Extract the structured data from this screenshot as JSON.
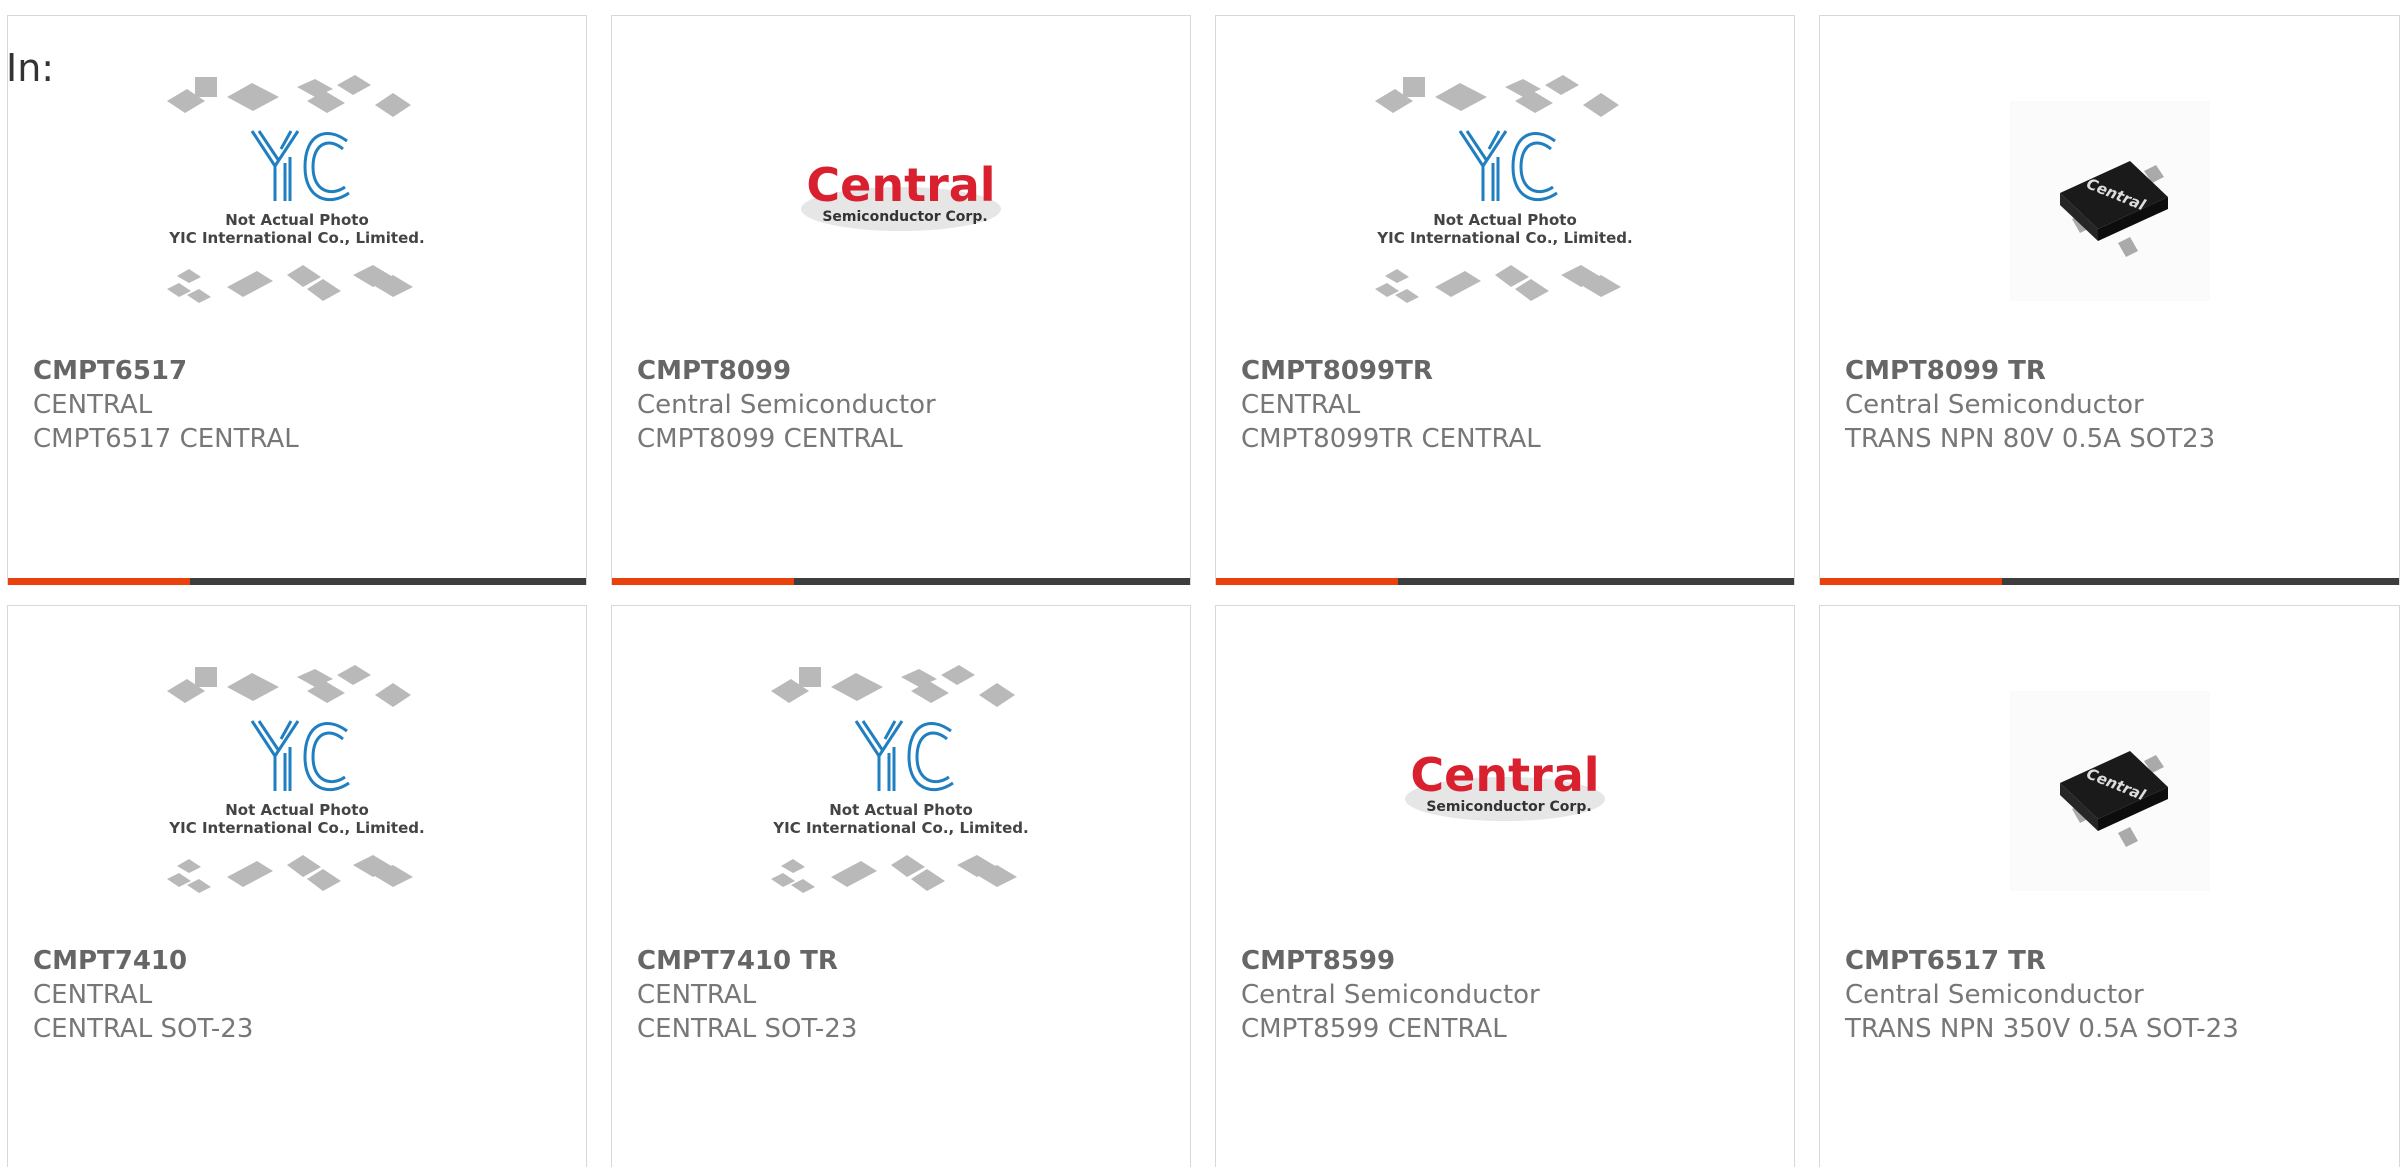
{
  "header": {
    "in_label": "In:"
  },
  "colors": {
    "accent": "#e8410c",
    "bar": "#3d3d3d",
    "yic_blue": "#1f7fc0",
    "central_red": "#d8202e"
  },
  "products": [
    {
      "part": "CMPT6517",
      "manufacturer": "CENTRAL",
      "description": "CMPT6517 CENTRAL",
      "image": "yic-placeholder",
      "image_caption_1": "Not Actual Photo",
      "image_caption_2": "YIC International Co., Limited."
    },
    {
      "part": "CMPT8099",
      "manufacturer": "Central Semiconductor",
      "description": "CMPT8099 CENTRAL",
      "image": "central-logo",
      "logo_main": "Central",
      "logo_sub": "Semiconductor Corp."
    },
    {
      "part": "CMPT8099TR",
      "manufacturer": "CENTRAL",
      "description": "CMPT8099TR CENTRAL",
      "image": "yic-placeholder",
      "image_caption_1": "Not Actual Photo",
      "image_caption_2": "YIC International Co., Limited."
    },
    {
      "part": "CMPT8099 TR",
      "manufacturer": "Central Semiconductor",
      "description": "TRANS NPN 80V 0.5A SOT23",
      "image": "sot23-chip"
    },
    {
      "part": "CMPT7410",
      "manufacturer": "CENTRAL",
      "description": "CENTRAL SOT-23",
      "image": "yic-placeholder",
      "image_caption_1": "Not Actual Photo",
      "image_caption_2": "YIC International Co., Limited."
    },
    {
      "part": "CMPT7410 TR",
      "manufacturer": "CENTRAL",
      "description": "CENTRAL SOT-23",
      "image": "yic-placeholder",
      "image_caption_1": "Not Actual Photo",
      "image_caption_2": "YIC International Co., Limited."
    },
    {
      "part": "CMPT8599",
      "manufacturer": "Central Semiconductor",
      "description": "CMPT8599 CENTRAL",
      "image": "central-logo",
      "logo_main": "Central",
      "logo_sub": "Semiconductor Corp."
    },
    {
      "part": "CMPT6517 TR",
      "manufacturer": "Central Semiconductor",
      "description": "TRANS NPN 350V 0.5A SOT-23",
      "image": "sot23-chip"
    }
  ]
}
